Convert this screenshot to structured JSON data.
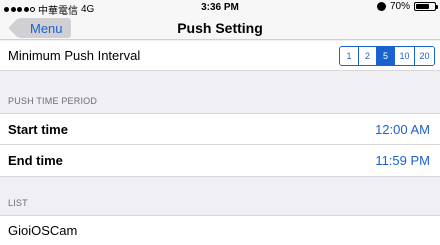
{
  "status_bar": {
    "carrier": "中華電信",
    "network": "4G",
    "signal_bars_filled": 4,
    "signal_bars_total": 5,
    "time": "3:36 PM",
    "battery": "70%",
    "battery_level": 0.7
  },
  "nav": {
    "back_label": "Menu",
    "title": "Push Setting"
  },
  "interval": {
    "label": "Minimum Push Interval",
    "options": [
      "1",
      "2",
      "5",
      "10",
      "20"
    ],
    "selected": "5"
  },
  "push_time_period": {
    "header": "PUSH TIME PERIOD",
    "start_label": "Start time",
    "start_value": "12:00 AM",
    "end_label": "End time",
    "end_value": "11:59 PM"
  },
  "list": {
    "header": "LIST",
    "items": [
      {
        "name": "GioiOSCam"
      }
    ]
  },
  "colors": {
    "accent": "#1a62d0",
    "background": "#efeff4"
  }
}
